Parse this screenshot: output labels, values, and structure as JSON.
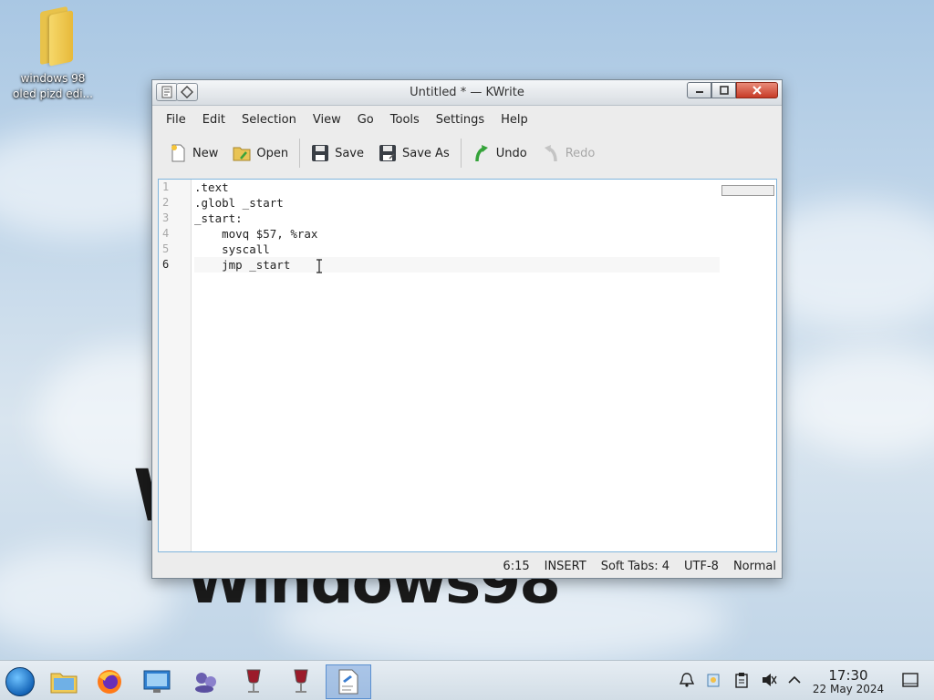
{
  "desktop": {
    "icon_label": "windows 98 oled pizd edi...",
    "wallpaper_text": "Windows 98"
  },
  "window": {
    "title": "Untitled * — KWrite",
    "menu": [
      "File",
      "Edit",
      "Selection",
      "View",
      "Go",
      "Tools",
      "Settings",
      "Help"
    ],
    "toolbar": {
      "new": "New",
      "open": "Open",
      "save": "Save",
      "save_as": "Save As",
      "undo": "Undo",
      "redo": "Redo"
    },
    "editor": {
      "line_numbers": [
        "1",
        "2",
        "3",
        "4",
        "5",
        "6"
      ],
      "lines": [
        ".text",
        ".globl _start",
        "_start:",
        "    movq $57, %rax",
        "    syscall",
        "    jmp _start"
      ],
      "current_line": 6
    },
    "status": {
      "position": "6:15",
      "mode": "INSERT",
      "indent": "Soft Tabs: 4",
      "encoding": "UTF-8",
      "syntax": "Normal"
    }
  },
  "taskbar": {
    "clock_time": "17:30",
    "clock_date": "22 May 2024"
  },
  "colors": {
    "accent": "#7fb4dc",
    "close_button": "#c73a26"
  }
}
